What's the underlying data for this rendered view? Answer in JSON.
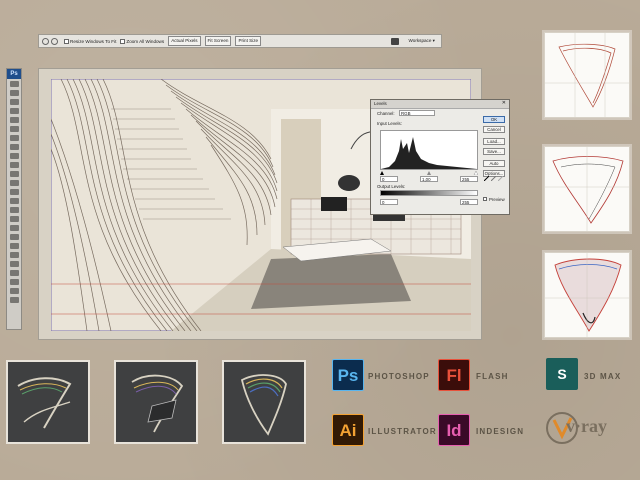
{
  "optionsbar": {
    "resize_windows": "Resize Windows To Fit",
    "zoom_all": "Zoom All Windows",
    "actual_pixels": "Actual Pixels",
    "fit_screen": "Fit Screen",
    "print_size": "Print Size",
    "workspace": "Workspace ▾"
  },
  "tools": {
    "logo": "Ps"
  },
  "levels": {
    "title": "Levels",
    "channel_label": "Channel:",
    "channel_value": "RGB",
    "input_label": "Input Levels:",
    "input_black": "0",
    "input_gamma": "1,00",
    "input_white": "255",
    "output_label": "Output Levels:",
    "output_black": "0",
    "output_white": "255",
    "buttons": [
      "OK",
      "Cancel",
      "Load...",
      "Save...",
      "Auto",
      "Options..."
    ],
    "preview_label": "Preview"
  },
  "software": {
    "photoshop": {
      "abbr": "Ps",
      "name": "PHOTOSHOP"
    },
    "flash": {
      "abbr": "Fl",
      "name": "FLASH"
    },
    "max": {
      "abbr": "S",
      "name": "3D MAX"
    },
    "illustrator": {
      "abbr": "Ai",
      "name": "ILLUSTRATOR"
    },
    "indesign": {
      "abbr": "Id",
      "name": "INDESIGN"
    },
    "vray": {
      "name": "v·ray"
    }
  },
  "colors": {
    "background": "#b9ab98",
    "photoshop": "#59b5ee",
    "flash": "#e8513b",
    "illustrator": "#f3a233",
    "indesign": "#e65fb0",
    "max": "#1a5e5a"
  }
}
